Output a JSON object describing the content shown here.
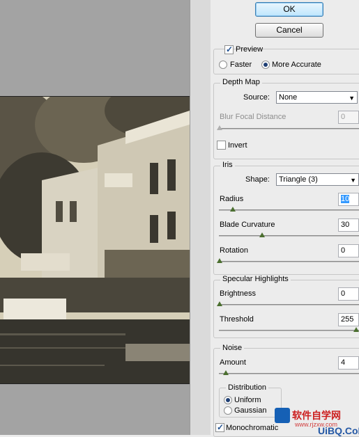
{
  "buttons": {
    "ok": "OK",
    "cancel": "Cancel"
  },
  "preview": {
    "label": "Preview",
    "checked": true,
    "faster": "Faster",
    "more_accurate": "More Accurate",
    "selected": "More Accurate"
  },
  "depth_map": {
    "title": "Depth Map",
    "source_label": "Source:",
    "source_value": "None",
    "blur_focal_label": "Blur Focal Distance",
    "blur_focal_value": "0",
    "invert_label": "Invert",
    "invert_checked": false
  },
  "iris": {
    "title": "Iris",
    "shape_label": "Shape:",
    "shape_value": "Triangle (3)",
    "radius_label": "Radius",
    "radius_value": "10",
    "blade_label": "Blade Curvature",
    "blade_value": "30",
    "rotation_label": "Rotation",
    "rotation_value": "0"
  },
  "specular": {
    "title": "Specular Highlights",
    "brightness_label": "Brightness",
    "brightness_value": "0",
    "threshold_label": "Threshold",
    "threshold_value": "255"
  },
  "noise": {
    "title": "Noise",
    "amount_label": "Amount",
    "amount_value": "4",
    "distribution_title": "Distribution",
    "uniform": "Uniform",
    "gaussian": "Gaussian",
    "selected": "Uniform",
    "monochromatic_label": "Monochromatic",
    "monochromatic_checked": true
  },
  "watermark": {
    "brand": "软件自学网",
    "url": "www.rjzxw.com",
    "big": "UiBQ.CoM"
  }
}
